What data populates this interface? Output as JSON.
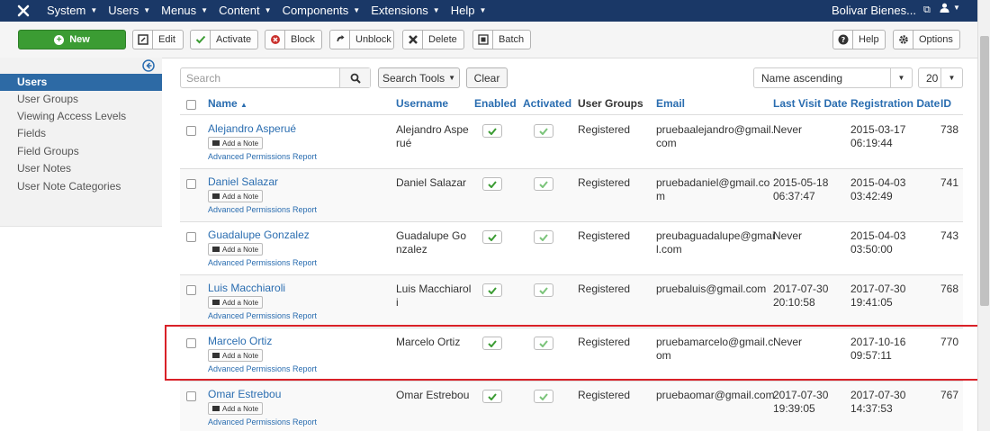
{
  "nav": {
    "menus": [
      "System",
      "Users",
      "Menus",
      "Content",
      "Components",
      "Extensions",
      "Help"
    ],
    "site_name": "Bolivar Bienes..."
  },
  "toolbar": {
    "new": "New",
    "edit": "Edit",
    "activate": "Activate",
    "block": "Block",
    "unblock": "Unblock",
    "delete": "Delete",
    "batch": "Batch",
    "help": "Help",
    "options": "Options"
  },
  "sidebar": {
    "items": [
      "Users",
      "User Groups",
      "Viewing Access Levels",
      "Fields",
      "Field Groups",
      "User Notes",
      "User Note Categories"
    ]
  },
  "filters": {
    "search_placeholder": "Search",
    "search_tools": "Search Tools",
    "clear": "Clear",
    "ordering": "Name ascending",
    "limit": "20"
  },
  "table": {
    "headers": {
      "name": "Name",
      "username": "Username",
      "enabled": "Enabled",
      "activated": "Activated",
      "groups": "User Groups",
      "email": "Email",
      "last_visit": "Last Visit Date",
      "registration": "Registration Date",
      "id": "ID"
    },
    "add_note": "Add a Note",
    "permissions_report": "Advanced Permissions Report",
    "rows": [
      {
        "name": "Alejandro Asperué",
        "username_1": "Alejandro Aspe",
        "username_2": "rué",
        "group": "Registered",
        "email_1": "pruebaalejandro@gmail.",
        "email_2": "com",
        "last_1": "Never",
        "last_2": "",
        "reg_1": "2015-03-17",
        "reg_2": "06:19:44",
        "id": "738"
      },
      {
        "name": "Daniel Salazar",
        "username_1": "Daniel Salazar",
        "username_2": "",
        "group": "Registered",
        "email_1": "pruebadaniel@gmail.co",
        "email_2": "m",
        "last_1": "2015-05-18",
        "last_2": "06:37:47",
        "reg_1": "2015-04-03",
        "reg_2": "03:42:49",
        "id": "741"
      },
      {
        "name": "Guadalupe Gonzalez",
        "username_1": "Guadalupe Go",
        "username_2": "nzalez",
        "group": "Registered",
        "email_1": "preubaguadalupe@gmai",
        "email_2": "l.com",
        "last_1": "Never",
        "last_2": "",
        "reg_1": "2015-04-03",
        "reg_2": "03:50:00",
        "id": "743"
      },
      {
        "name": "Luis Macchiaroli",
        "username_1": "Luis Macchiarol",
        "username_2": "i",
        "group": "Registered",
        "email_1": "pruebaluis@gmail.com",
        "email_2": "",
        "last_1": "2017-07-30",
        "last_2": "20:10:58",
        "reg_1": "2017-07-30",
        "reg_2": "19:41:05",
        "id": "768"
      },
      {
        "name": "Marcelo Ortiz",
        "username_1": "Marcelo Ortiz",
        "username_2": "",
        "group": "Registered",
        "email_1": "pruebamarcelo@gmail.c",
        "email_2": "om",
        "last_1": "Never",
        "last_2": "",
        "reg_1": "2017-10-16",
        "reg_2": "09:57:11",
        "id": "770"
      },
      {
        "name": "Omar Estrebou",
        "username_1": "Omar Estrebou",
        "username_2": "",
        "group": "Registered",
        "email_1": "pruebaomar@gmail.com",
        "email_2": "",
        "last_1": "2017-07-30",
        "last_2": "19:39:05",
        "reg_1": "2017-07-30",
        "reg_2": "14:37:53",
        "id": "767"
      }
    ]
  },
  "colors": {
    "nav": "#1a3867",
    "new_button": "#3b9c33",
    "active_sidebar": "#2d6aa5",
    "link": "#2a6db0",
    "highlight": "#d92128"
  }
}
